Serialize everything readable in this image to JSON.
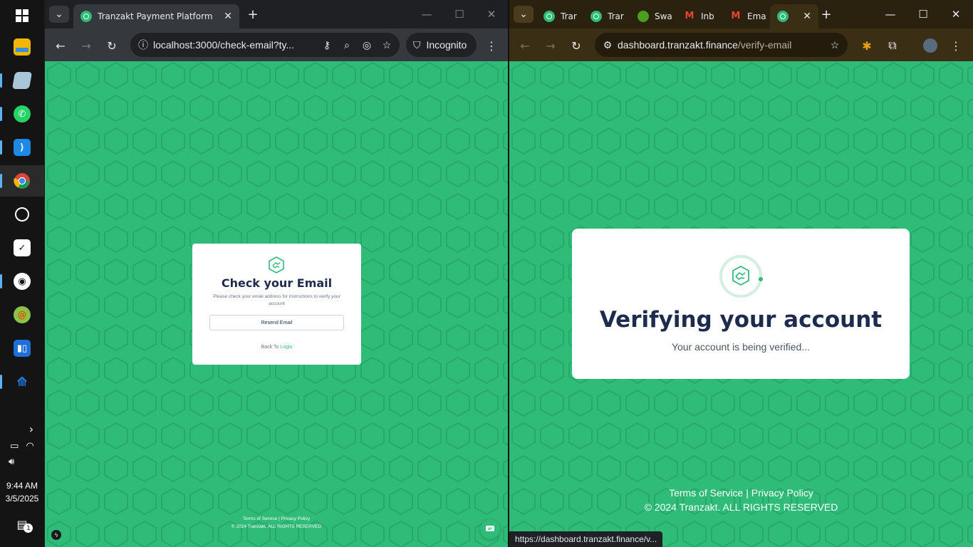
{
  "taskbar": {
    "apps": [
      {
        "name": "file-explorer-icon"
      },
      {
        "name": "notes-app-icon"
      },
      {
        "name": "whatsapp-icon"
      },
      {
        "name": "vscode-icon"
      },
      {
        "name": "chrome-icon"
      },
      {
        "name": "chatgpt-icon"
      },
      {
        "name": "tasks-app-icon"
      },
      {
        "name": "github-icon"
      },
      {
        "name": "chameleon-app-icon"
      },
      {
        "name": "trello-icon"
      },
      {
        "name": "jira-icon"
      }
    ],
    "time": "9:44 AM",
    "date": "3/5/2025",
    "notification_count": "1"
  },
  "left_window": {
    "tab_title": "Tranzakt Payment Platform",
    "url": "localhost:3000/check-email?ty...",
    "incognito_label": "Incognito",
    "page": {
      "heading": "Check your Email",
      "description": "Please check your email address for instructions to verify your account",
      "resend_label": "Resend Email",
      "back_to_text": "Back To",
      "login_link": "Login",
      "footer_links": "Terms of Service | Privacy Policy",
      "footer_copyright": "© 2024 Tranzakt. ALL RIGHTS RESERVED"
    }
  },
  "right_window": {
    "tabs": [
      {
        "title": "Trar",
        "icon": "tranzakt-icon"
      },
      {
        "title": "Trar",
        "icon": "tranzakt-icon"
      },
      {
        "title": "Swa",
        "icon": "globe-icon"
      },
      {
        "title": "Inb",
        "icon": "gmail-icon"
      },
      {
        "title": "Ema",
        "icon": "gmail-icon"
      }
    ],
    "url_host": "dashboard.tranzakt.finance",
    "url_path": "/verify-email",
    "page": {
      "heading": "Verifying your account",
      "subheading": "Your account is being verified...",
      "footer_links": "Terms of Service | Privacy Policy",
      "footer_copyright": "© 2024 Tranzakt. ALL RIGHTS RESERVED"
    },
    "status_url": "https://dashboard.tranzakt.finance/v..."
  },
  "colors": {
    "brand_green": "#2fbb78",
    "heading_navy": "#1d2b4f"
  }
}
